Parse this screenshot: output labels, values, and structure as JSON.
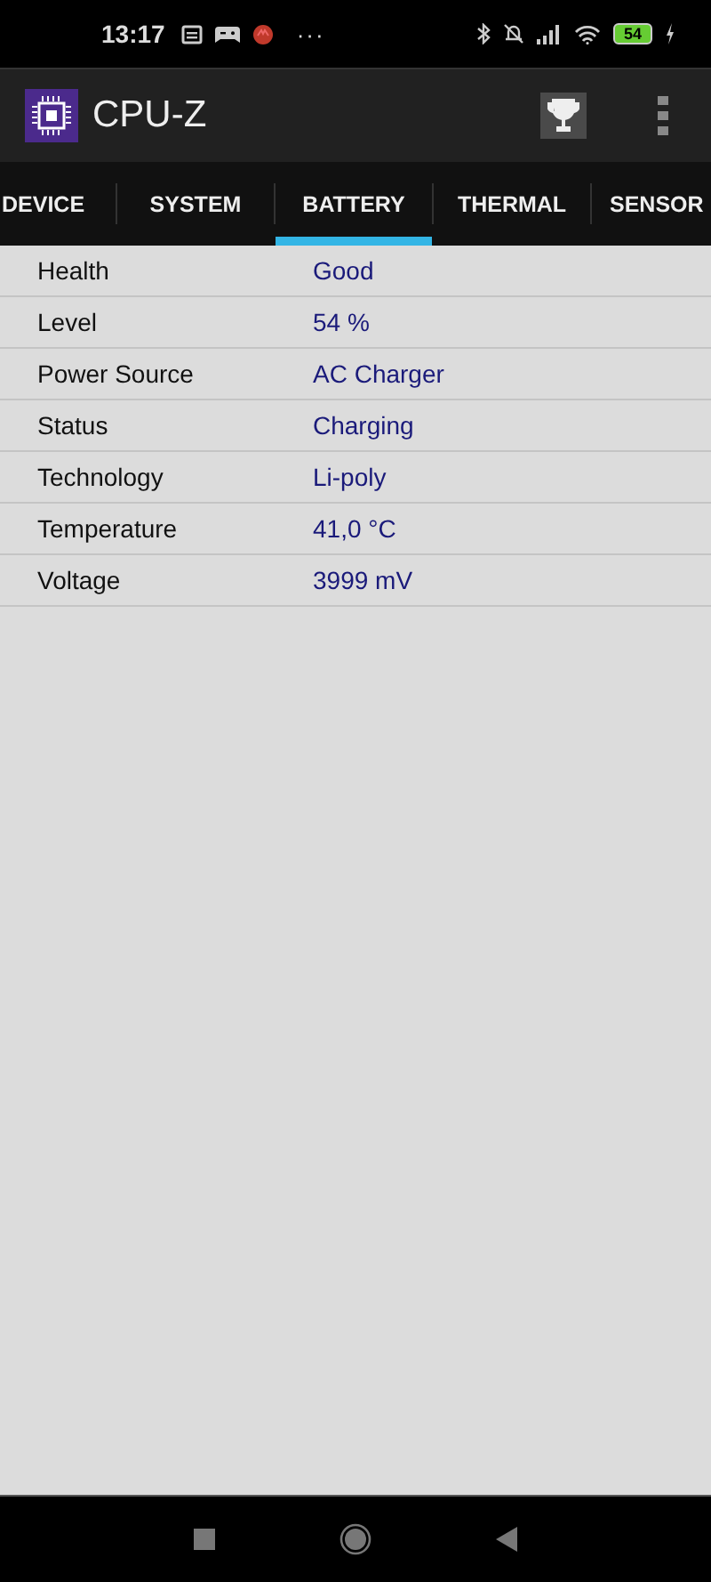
{
  "status_bar": {
    "time": "13:17",
    "more": "···",
    "battery": "54"
  },
  "app_bar": {
    "title": "CPU-Z"
  },
  "tabs": [
    {
      "label": "DEVICE",
      "selected": false
    },
    {
      "label": "SYSTEM",
      "selected": false
    },
    {
      "label": "BATTERY",
      "selected": true
    },
    {
      "label": "THERMAL",
      "selected": false
    },
    {
      "label": "SENSOR",
      "selected": false
    }
  ],
  "rows": [
    {
      "label": "Health",
      "value": "Good"
    },
    {
      "label": "Level",
      "value": "54 %"
    },
    {
      "label": "Power Source",
      "value": "AC Charger"
    },
    {
      "label": "Status",
      "value": "Charging"
    },
    {
      "label": "Technology",
      "value": "Li-poly"
    },
    {
      "label": "Temperature",
      "value": "41,0 °C"
    },
    {
      "label": "Voltage",
      "value": "3999 mV"
    }
  ]
}
